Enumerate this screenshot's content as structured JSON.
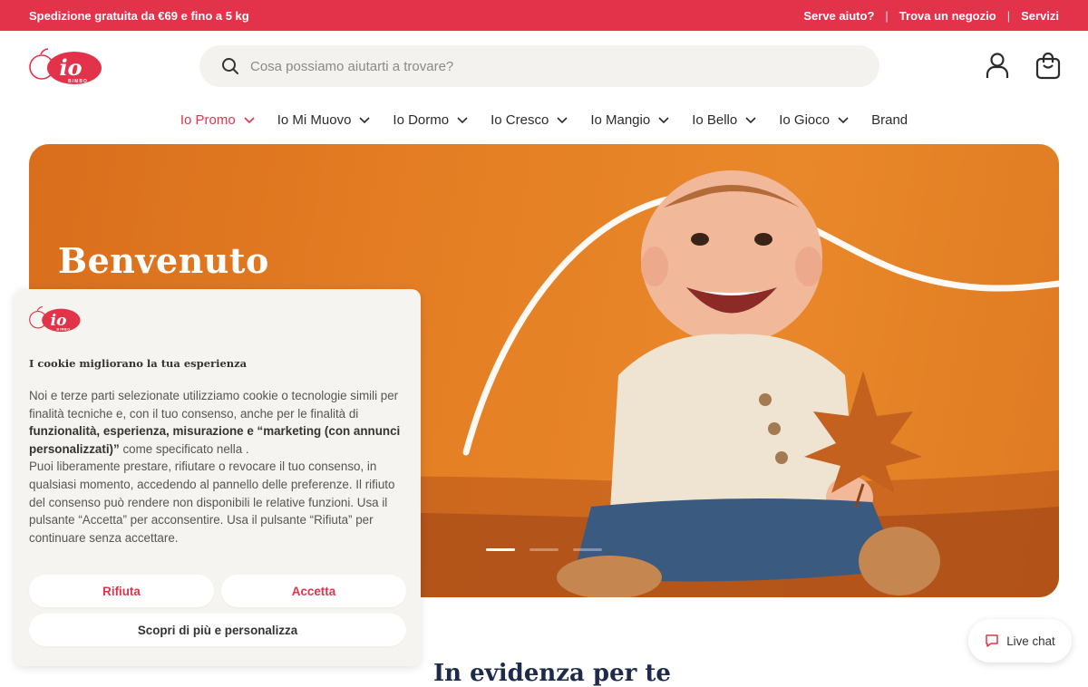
{
  "topbar": {
    "promo": "Spedizione gratuita da €69 e fino a 5 kg",
    "links": [
      "Serve aiuto?",
      "Trova un negozio",
      "Servizi"
    ],
    "separator": "|"
  },
  "logo": {
    "text": "io",
    "subtext": "BIMBO"
  },
  "search": {
    "placeholder": "Cosa possiamo aiutarti a trovare?"
  },
  "header_icons": [
    "user-icon",
    "cart-icon"
  ],
  "nav": {
    "items": [
      {
        "label": "Io Promo",
        "dropdown": true,
        "active": true
      },
      {
        "label": "Io Mi Muovo",
        "dropdown": true
      },
      {
        "label": "Io Dormo",
        "dropdown": true
      },
      {
        "label": "Io Cresco",
        "dropdown": true
      },
      {
        "label": "Io Mangio",
        "dropdown": true
      },
      {
        "label": "Io Bello",
        "dropdown": true
      },
      {
        "label": "Io Gioco",
        "dropdown": true
      },
      {
        "label": "Brand",
        "dropdown": false
      }
    ]
  },
  "hero": {
    "title": "Benvenuto",
    "slides": {
      "count": 3,
      "active": 1
    }
  },
  "section": {
    "title": "In evidenza per te"
  },
  "cookie": {
    "title": "I cookie migliorano la tua esperienza",
    "text_1": "Noi e terze parti selezionate utilizziamo cookie o tecnologie simili per finalità tecniche e, con il tuo consenso, anche per le finalità di ",
    "text_bold": "funzionalità, esperienza, misurazione e “marketing (con annunci personalizzati)”",
    "text_2": " come specificato nella .",
    "text_3": "Puoi liberamente prestare, rifiutare o revocare il tuo consenso, in qualsiasi momento, accedendo al pannello delle preferenze. Il rifiuto del consenso può rendere non disponibili le relative funzioni. Usa il pulsante “Accetta” per acconsentire. Usa il pulsante “Rifiuta” per continuare senza accettare.",
    "reject": "Rifiuta",
    "accept": "Accetta",
    "more": "Scopri di più e personalizza"
  },
  "livechat": {
    "label": "Live chat"
  },
  "colors": {
    "brand": "#e2334a",
    "hero_orange": "#e5822a",
    "cookie_bg": "#f6f4f0"
  }
}
